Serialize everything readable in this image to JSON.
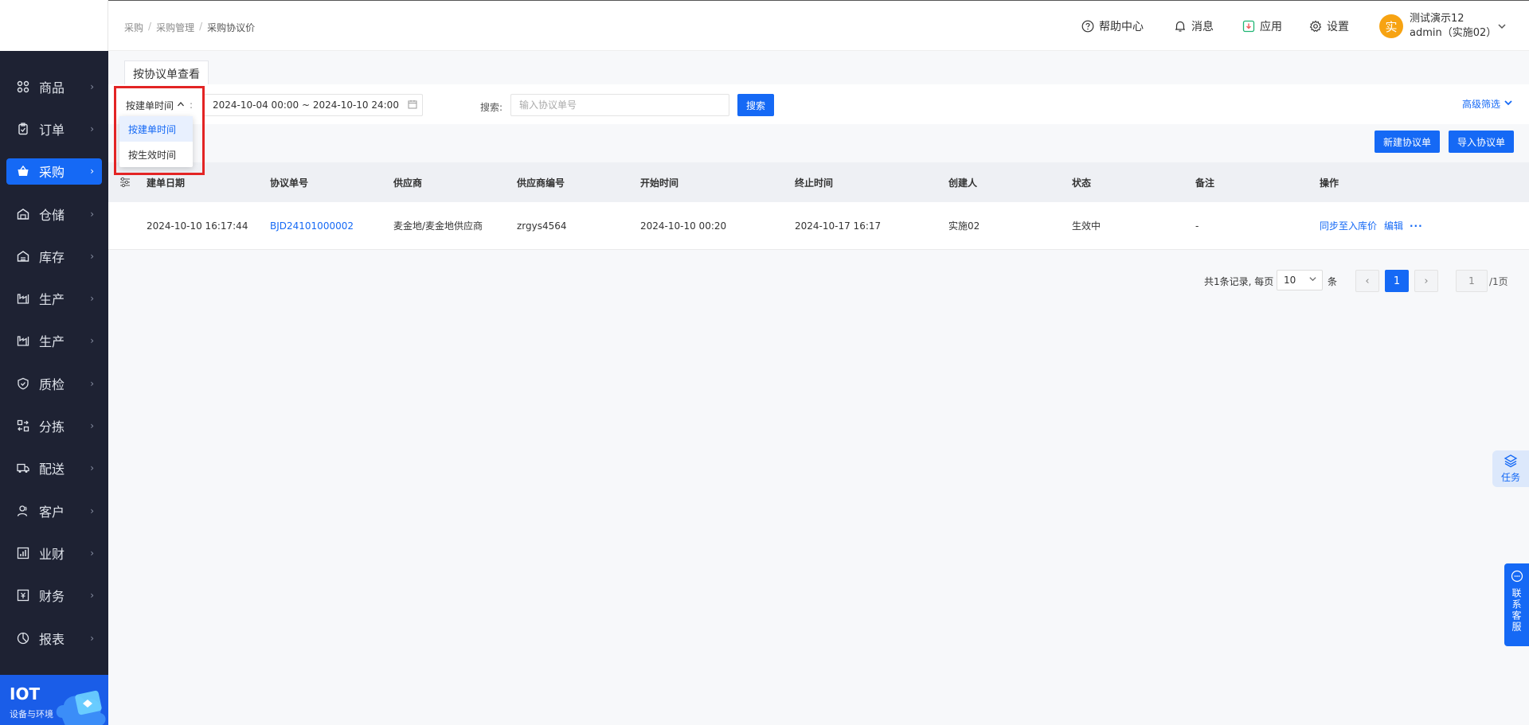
{
  "sidebar": {
    "items": [
      {
        "label": "商品",
        "icon": "grid-icon"
      },
      {
        "label": "订单",
        "icon": "clipboard-icon"
      },
      {
        "label": "采购",
        "icon": "basket-icon"
      },
      {
        "label": "仓储",
        "icon": "warehouse-icon"
      },
      {
        "label": "库存",
        "icon": "inventory-icon"
      },
      {
        "label": "生产",
        "icon": "factory-icon"
      },
      {
        "label": "生产",
        "icon": "factory-icon"
      },
      {
        "label": "质检",
        "icon": "shield-check-icon"
      },
      {
        "label": "分拣",
        "icon": "sort-icon"
      },
      {
        "label": "配送",
        "icon": "truck-icon"
      },
      {
        "label": "客户",
        "icon": "user-icon"
      },
      {
        "label": "业财",
        "icon": "finance-chart-icon"
      },
      {
        "label": "财务",
        "icon": "ledger-icon"
      },
      {
        "label": "报表",
        "icon": "pie-icon"
      }
    ],
    "active_index": 2,
    "iot": {
      "title": "IOT",
      "subtitle": "设备与环境"
    }
  },
  "header": {
    "breadcrumb": [
      "采购",
      "采购管理",
      "采购协议价"
    ],
    "help": "帮助中心",
    "messages": "消息",
    "apps": "应用",
    "settings": "设置",
    "user": {
      "avatar_char": "实",
      "name": "测试演示12",
      "sub": "admin（实施02）"
    }
  },
  "tab": {
    "label": "按协议单查看"
  },
  "filters": {
    "time_type": "按建单时间",
    "date_range": "2024-10-04 00:00 ~ 2024-10-10 24:00",
    "search_label": "搜索:",
    "search_placeholder": "输入协议单号",
    "search_button": "搜索",
    "advanced": "高级筛选",
    "dropdown_options": [
      "按建单时间",
      "按生效时间"
    ]
  },
  "actions": {
    "new": "新建协议单",
    "import": "导入协议单"
  },
  "table": {
    "columns": [
      "建单日期",
      "协议单号",
      "供应商",
      "供应商编号",
      "开始时间",
      "终止时间",
      "创建人",
      "状态",
      "备注",
      "操作"
    ],
    "rows": [
      {
        "created": "2024-10-10 16:17:44",
        "order_no": "BJD24101000002",
        "supplier": "麦金地/麦金地供应商",
        "supplier_code": "zrgys4564",
        "start": "2024-10-10 00:20",
        "end": "2024-10-17 16:17",
        "creator": "实施02",
        "status": "生效中",
        "remark": "-",
        "op_sync": "同步至入库价",
        "op_edit": "编辑",
        "op_more": "···"
      }
    ]
  },
  "pagination": {
    "total_text": "共1条记录, 每页",
    "page_size": "10",
    "unit": "条",
    "prev": "‹",
    "current": "1",
    "next": "›",
    "jump_value": "1",
    "pages_text": "/1页"
  },
  "floats": {
    "task": "任务",
    "service": "联系客服"
  },
  "colors": {
    "primary": "#1569f5",
    "sidebar": "#1e2233",
    "highlight": "#e32424",
    "avatar": "#f7a312"
  }
}
